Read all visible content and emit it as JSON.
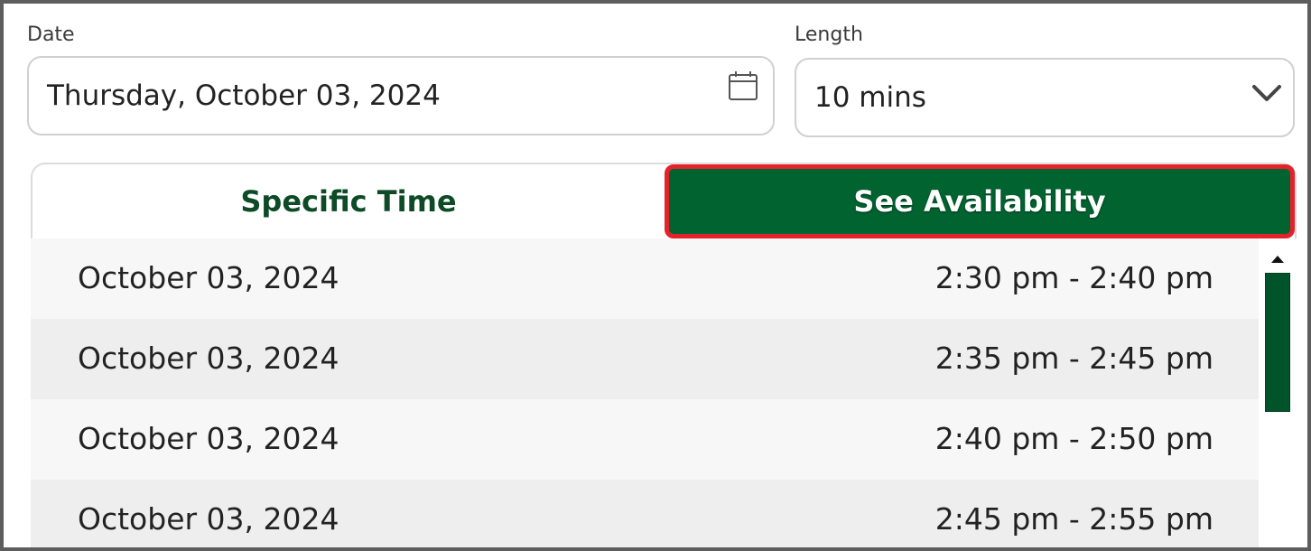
{
  "date_field": {
    "label": "Date",
    "value": "Thursday, October 03, 2024",
    "icon": "calendar-icon"
  },
  "length_field": {
    "label": "Length",
    "value": "10 mins",
    "icon": "chevron-down-icon"
  },
  "tabs": [
    {
      "label": "Specific Time",
      "active": false
    },
    {
      "label": "See Availability",
      "active": true
    }
  ],
  "slots": [
    {
      "date": "October 03, 2024",
      "time": "2:30 pm - 2:40 pm"
    },
    {
      "date": "October 03, 2024",
      "time": "2:35 pm - 2:45 pm"
    },
    {
      "date": "October 03, 2024",
      "time": "2:40 pm - 2:50 pm"
    },
    {
      "date": "October 03, 2024",
      "time": "2:45 pm - 2:55 pm"
    }
  ],
  "colors": {
    "accent_green": "#016430",
    "tab_text_green": "#0d4a26",
    "highlight_red": "#e3222b"
  }
}
